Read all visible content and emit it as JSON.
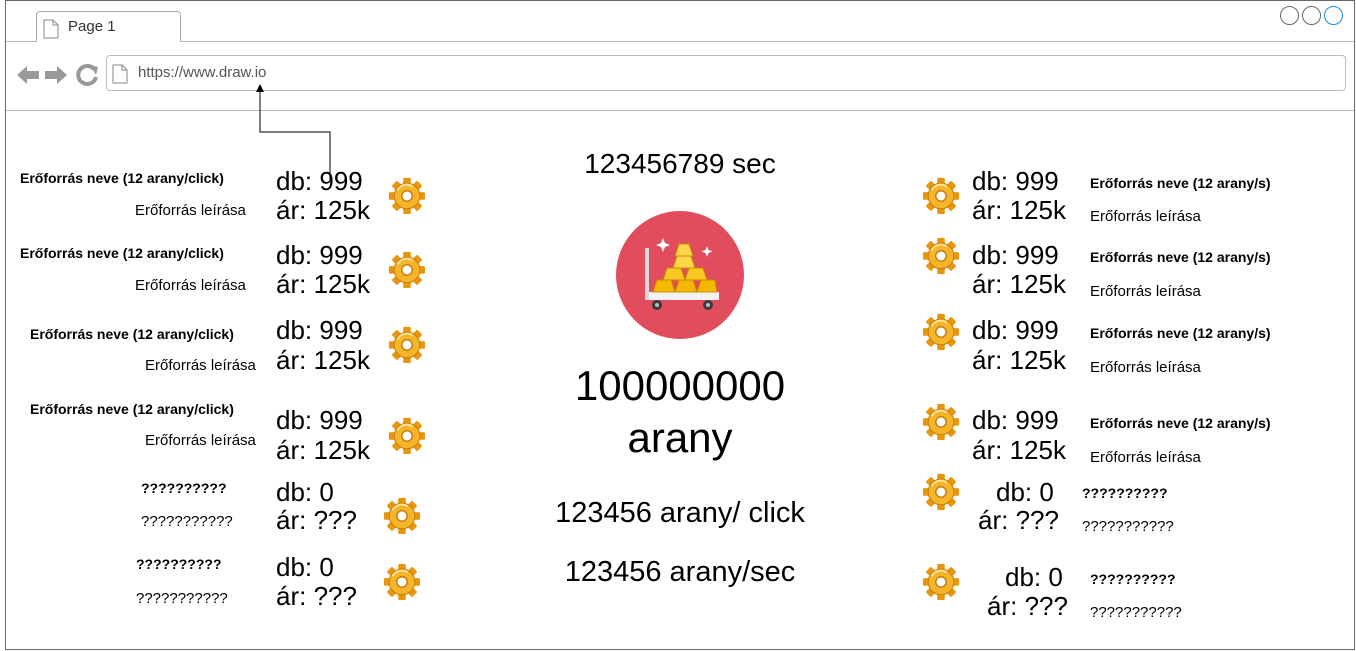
{
  "browser": {
    "tab_label": "Page 1",
    "url": "https://www.draw.io"
  },
  "center": {
    "time": "123456789 sec",
    "gold_amount": "100000000",
    "gold_unit": "arany",
    "per_click": "123456 arany/ click",
    "per_sec": "123456 arany/sec"
  },
  "left_resources": [
    {
      "name": "Erőforrás neve (12 arany/click)",
      "desc": "Erőforrás leírása",
      "count": "db:  999",
      "price": "ár: 125k"
    },
    {
      "name": "Erőforrás neve (12 arany/click)",
      "desc": "Erőforrás leírása",
      "count": "db:  999",
      "price": "ár: 125k"
    },
    {
      "name": "Erőforrás neve (12 arany/click)",
      "desc": "Erőforrás leírása",
      "count": "db:  999",
      "price": "ár: 125k"
    },
    {
      "name": "Erőforrás neve (12 arany/click)",
      "desc": "Erőforrás leírása",
      "count": "db:  999",
      "price": "ár: 125k"
    },
    {
      "name": "??????????",
      "desc": "???????????",
      "count": "db:  0",
      "price": "ár: ???"
    },
    {
      "name": "??????????",
      "desc": "???????????",
      "count": "db:  0",
      "price": "ár: ???"
    }
  ],
  "right_resources": [
    {
      "name": "Erőforrás neve (12 arany/s)",
      "desc": "Erőforrás leírása",
      "count": "db:  999",
      "price": "ár: 125k"
    },
    {
      "name": "Erőforrás neve (12 arany/s)",
      "desc": "Erőforrás leírása",
      "count": "db:  999",
      "price": "ár: 125k"
    },
    {
      "name": "Erőforrás neve (12 arany/s)",
      "desc": "Erőforrás leírása",
      "count": "db:  999",
      "price": "ár: 125k"
    },
    {
      "name": "Erőforrás neve (12 arany/s)",
      "desc": "Erőforrás leírása",
      "count": "db:  999",
      "price": "ár: 125k"
    },
    {
      "name": "??????????",
      "desc": "???????????",
      "count": "db:  0",
      "price": "ár: ???"
    },
    {
      "name": "??????????",
      "desc": "???????????",
      "count": "db:  0",
      "price": "ár: ???"
    }
  ],
  "icons": {
    "gear": "gear-icon",
    "gold_cart": "gold-cart-icon"
  },
  "colors": {
    "gold_circle": "#e14d5c",
    "gold": "#f5b800",
    "gear": "#f2a516"
  }
}
